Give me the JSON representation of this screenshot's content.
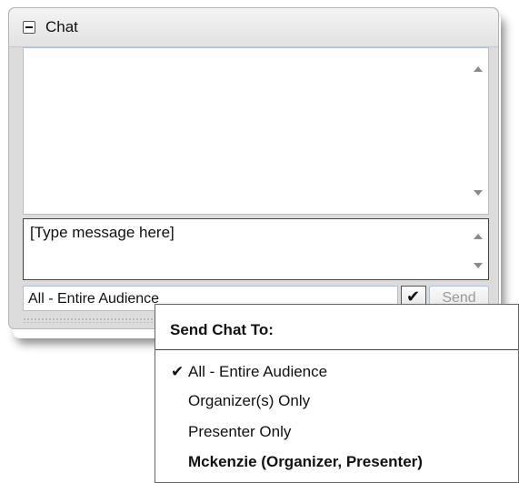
{
  "panel": {
    "title": "Chat",
    "collapse_icon": "minus-icon"
  },
  "chat_input": {
    "value": "[Type message here]"
  },
  "recipient": {
    "selected": "All - Entire Audience",
    "dropdown_icon": "chevron-down-icon",
    "send_label": "Send"
  },
  "menu": {
    "header": "Send Chat To:",
    "check_icon": "✔",
    "items": [
      {
        "label": "All - Entire Audience",
        "checked": true
      },
      {
        "label": "Organizer(s) Only"
      },
      {
        "label": "Presenter Only"
      },
      {
        "label": "Mckenzie (Organizer, Presenter)",
        "bold": true
      }
    ]
  },
  "colors": {
    "panel_bg": "#dcdcdc",
    "field_border": "#aebfd6",
    "disabled_text": "#9a9a9a"
  }
}
